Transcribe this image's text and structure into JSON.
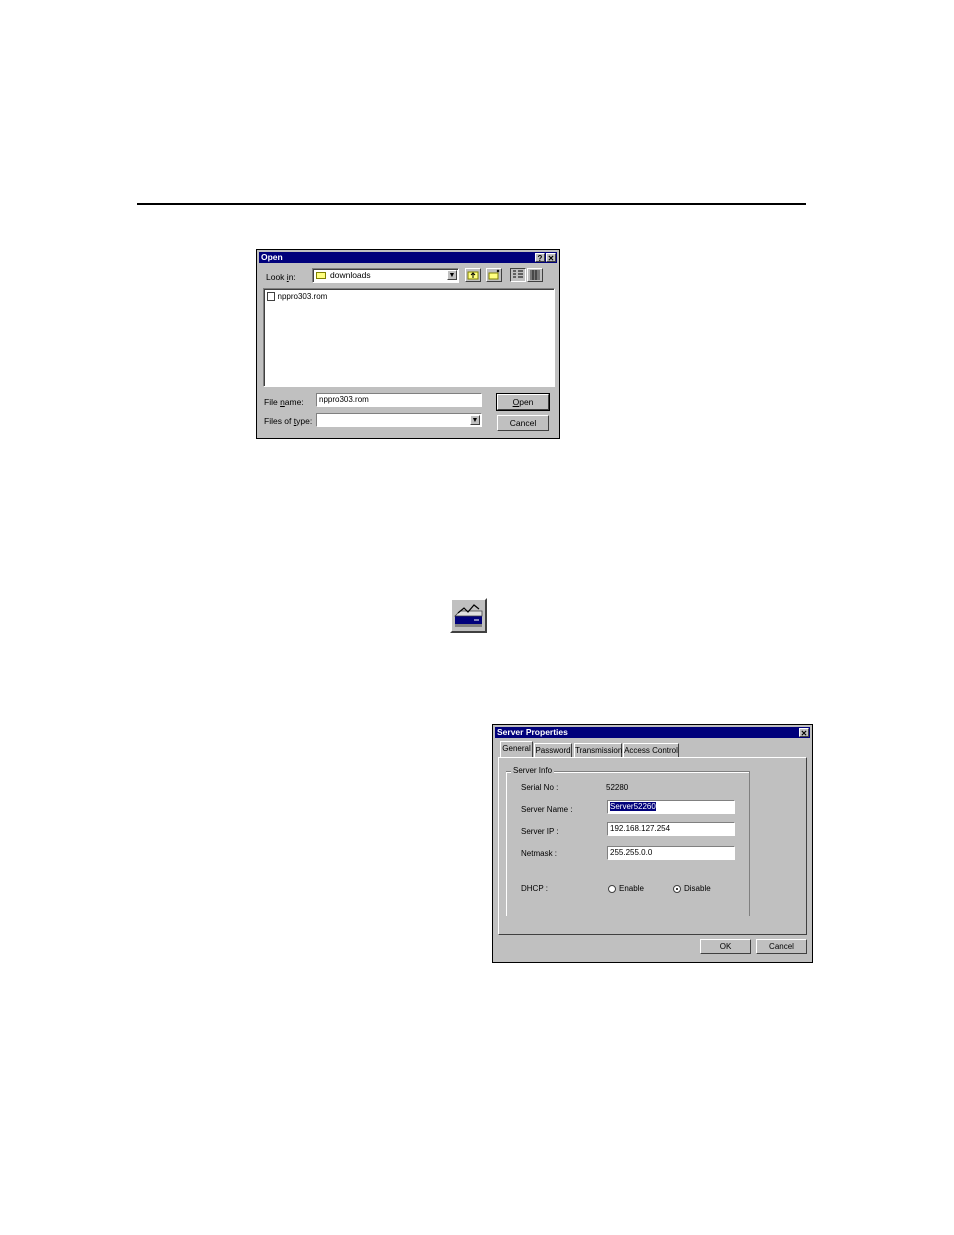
{
  "open_dialog": {
    "title": "Open",
    "help_button": "?",
    "close_button": "✕",
    "look_in_label_pre": "Look ",
    "look_in_label_u": "i",
    "look_in_label_post": "n:",
    "look_in_value": "downloads",
    "files": [
      {
        "name": "nppro303.rom"
      }
    ],
    "file_name_label_pre": "File ",
    "file_name_label_u": "n",
    "file_name_label_post": "ame:",
    "file_name_value": "nppro303.rom",
    "files_of_type_label_pre": "Files of ",
    "files_of_type_label_u": "t",
    "files_of_type_label_post": "ype:",
    "files_of_type_value": "",
    "open_label_u": "O",
    "open_label_post": "pen",
    "cancel_label": "Cancel"
  },
  "toolbar_icon": {
    "name": "server-config-icon"
  },
  "server_dialog": {
    "title": "Server Properties",
    "close_button": "✕",
    "tabs": [
      "General",
      "Password",
      "Transmission",
      "Access Control"
    ],
    "group_label": "Server Info",
    "serial_label": "Serial No :",
    "serial_value": "52280",
    "name_label": "Server Name :",
    "name_value": "Server52260",
    "ip_label": "Server IP :",
    "ip_value": "192.168.127.254",
    "netmask_label": "Netmask :",
    "netmask_value": "255.255.0.0",
    "dhcp_label": "DHCP :",
    "dhcp_enable": "Enable",
    "dhcp_disable": "Disable",
    "dhcp_selected": "Disable",
    "ok_label": "OK",
    "cancel_label": "Cancel"
  }
}
